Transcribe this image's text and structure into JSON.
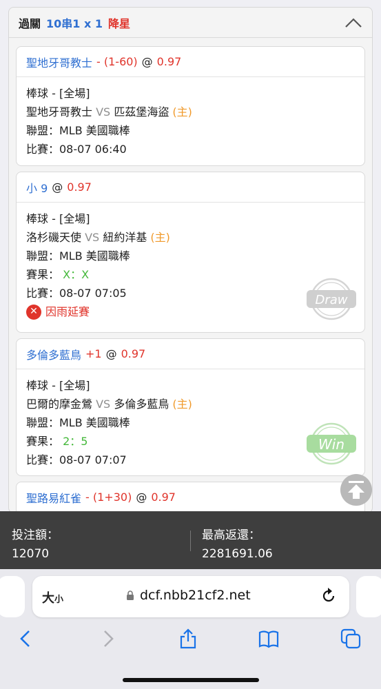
{
  "parlay": {
    "label": "過關",
    "combo": "10串1 x 1",
    "action": "降星"
  },
  "bets": [
    {
      "pick": "聖地牙哥教士",
      "handicap": "- (1-60)",
      "at": "@",
      "odds": "0.97",
      "sport_line": "棒球 - [全場]",
      "team_a": "聖地牙哥教士",
      "vs": "VS",
      "team_b": "匹茲堡海盜",
      "home_tag": "(主)",
      "league_line": "聯盟：MLB 美國職棒",
      "match_line": "比賽：08-07 06:40"
    },
    {
      "pick": "小 9",
      "at": "@",
      "odds": "0.97",
      "sport_line": "棒球 - [全場]",
      "team_a": "洛杉磯天使",
      "vs": "VS",
      "team_b": "紐約洋基",
      "home_tag": "(主)",
      "league_line": "聯盟：MLB 美國職棒",
      "result_label": "賽果：",
      "result_value": "X：X",
      "match_line": "比賽：08-07 07:05",
      "status": "因雨延賽",
      "stamp": "Draw"
    },
    {
      "pick": "多倫多藍鳥",
      "handicap": "+1",
      "at": "@",
      "odds": "0.97",
      "sport_line": "棒球 - [全場]",
      "team_a": "巴爾的摩金鶯",
      "vs": "VS",
      "team_b": "多倫多藍鳥",
      "home_tag": "(主)",
      "league_line": "聯盟：MLB 美國職棒",
      "result_label": "賽果：",
      "result_value": "2：5",
      "match_line": "比賽：08-07 07:07",
      "stamp": "Win"
    },
    {
      "pick": "聖路易紅雀",
      "handicap": "- (1+30)",
      "at": "@",
      "odds": "0.97"
    }
  ],
  "summary": {
    "stake_label": "投注額：",
    "stake_value": "12070",
    "max_return_label": "最高返還：",
    "max_return_value": "2281691.06"
  },
  "browser": {
    "text_size_big": "大",
    "text_size_small": "小",
    "url": "dcf.nbb21cf2.net"
  },
  "colors": {
    "blue": "#2f6fd1",
    "red": "#e0342b",
    "orange": "#f0992a",
    "green": "#44b83a",
    "ios_blue": "#1a73e8"
  }
}
